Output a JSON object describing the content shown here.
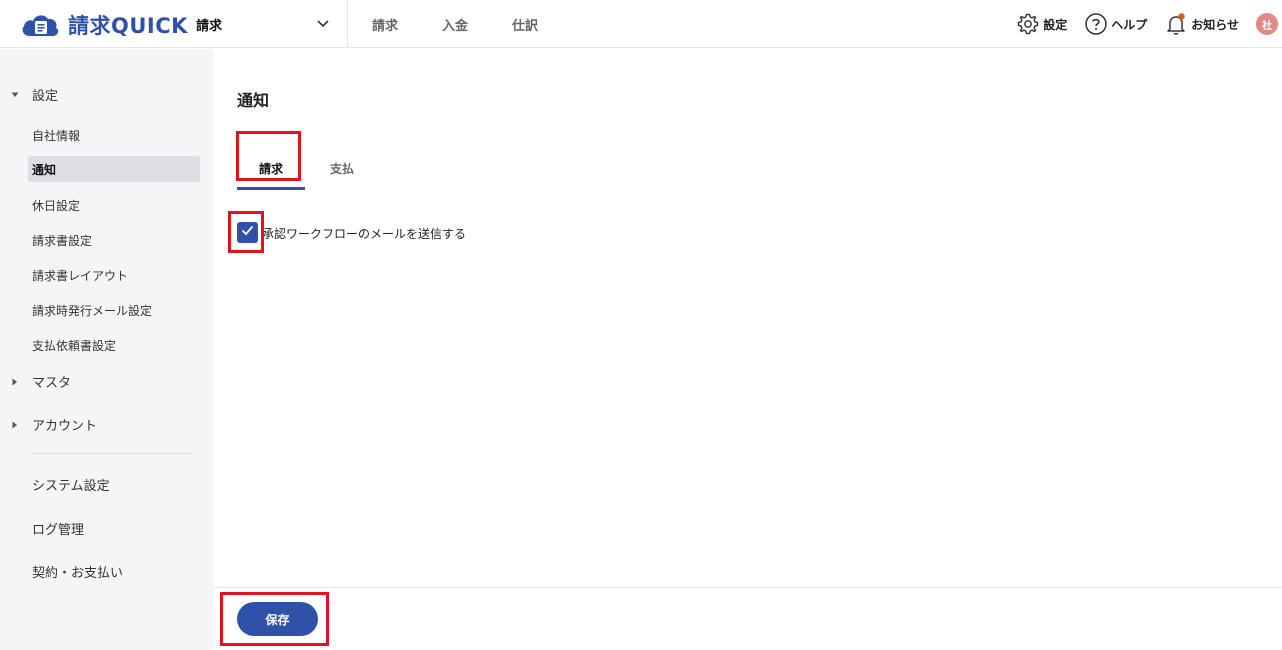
{
  "header": {
    "logo_text": "請求QUICK",
    "app_select": "請求",
    "nav": [
      "請求",
      "入金",
      "仕訳"
    ],
    "settings_label": "設定",
    "help_label": "ヘルプ",
    "notify_label": "お知らせ",
    "avatar_text": "社"
  },
  "sidebar": {
    "group_settings": "設定",
    "items": [
      "自社情報",
      "通知",
      "休日設定",
      "請求書設定",
      "請求書レイアウト",
      "請求時発行メール設定",
      "支払依頼書設定"
    ],
    "active_index": 1,
    "group_master": "マスタ",
    "group_account": "アカウント",
    "bottom": [
      "システム設定",
      "ログ管理",
      "契約・お支払い"
    ]
  },
  "main": {
    "title": "通知",
    "tabs": [
      "請求",
      "支払"
    ],
    "active_tab": 0,
    "checkbox_label": "承認ワークフローのメールを送信する",
    "checkbox_checked": true
  },
  "footer": {
    "save_label": "保存"
  },
  "colors": {
    "primary": "#2f52a8",
    "annotation": "#e0141e",
    "sidebar_bg": "#f4f5f7",
    "active_item_bg": "#dcdee3"
  }
}
